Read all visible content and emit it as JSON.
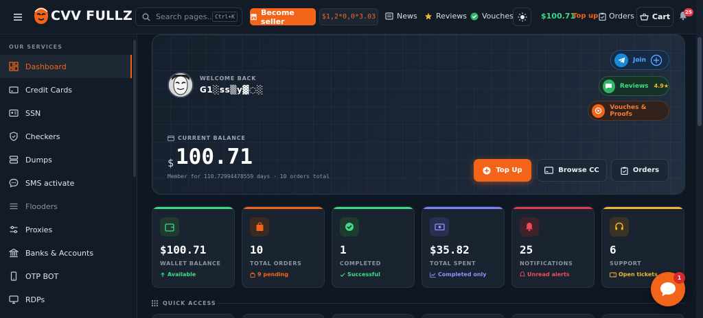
{
  "header": {
    "logo_text": "CVV FULLZ",
    "search_placeholder": "Search pages...",
    "search_shortcut": "Ctrl+K",
    "become_seller_label": "Become seller",
    "balance_ticker": "$1,2*0,0*3.03",
    "news_label": "News",
    "reviews_label": "Reviews",
    "vouches_label": "Vouches",
    "wallet_amount": "$100.71",
    "topup_label": "Top up",
    "orders_label": "Orders",
    "cart_label": "Cart",
    "notification_count": "25"
  },
  "sidebar": {
    "heading": "OUR SERVICES",
    "items": [
      {
        "label": "Dashboard",
        "icon": "dashboard-icon",
        "active": true
      },
      {
        "label": "Credit Cards",
        "icon": "credit-card-icon"
      },
      {
        "label": "SSN",
        "icon": "id-card-icon"
      },
      {
        "label": "Checkers",
        "icon": "shield-icon"
      },
      {
        "label": "Dumps",
        "icon": "database-icon"
      },
      {
        "label": "SMS activate",
        "icon": "chat-icon"
      },
      {
        "label": "Flooders",
        "icon": "list-icon",
        "muted": true
      },
      {
        "label": "Proxies",
        "icon": "sliders-icon"
      },
      {
        "label": "Banks & Accounts",
        "icon": "bank-icon"
      },
      {
        "label": "OTP BOT",
        "icon": "phone-icon"
      },
      {
        "label": "RDPs",
        "icon": "monitor-icon"
      }
    ]
  },
  "hero": {
    "welcome_label": "WELCOME BACK",
    "username": "G1░ss▒y▓◌░",
    "balance_label": "CURRENT BALANCE",
    "currency": "$",
    "balance_value": "100.71",
    "member_line": "Member for 110.72994478559 days  ·  10 orders total",
    "join_label": "Join",
    "reviews_label": "Reviews",
    "reviews_rating": "4.9★",
    "vouches_label": "Vouches & Proofs",
    "topup_button": "Top Up",
    "browse_button": "Browse CC",
    "orders_button": "Orders"
  },
  "stats": [
    {
      "value": "$100.71",
      "label": "WALLET BALANCE",
      "sub": "Available",
      "accent": "#3ddc84",
      "sub_color": "#3ddc84",
      "icon": "wallet-icon",
      "icon_bg": "#1f3a2e",
      "icon_color": "#3ddc84"
    },
    {
      "value": "10",
      "label": "TOTAL ORDERS",
      "sub": "9 pending",
      "accent": "#f26419",
      "sub_color": "#f26419",
      "icon": "shopping-bag-icon",
      "icon_bg": "#3b2a22",
      "icon_color": "#f26419"
    },
    {
      "value": "1",
      "label": "COMPLETED",
      "sub": "Successful",
      "accent": "#3ddc84",
      "sub_color": "#3ddc84",
      "icon": "check-circle-icon",
      "icon_bg": "#1f3a2e",
      "icon_color": "#3ddc84"
    },
    {
      "value": "$35.82",
      "label": "TOTAL SPENT",
      "sub": "Completed only",
      "accent": "#7c83f5",
      "sub_color": "#8b93ff",
      "icon": "cash-icon",
      "icon_bg": "#2a2f52",
      "icon_color": "#8b93ff"
    },
    {
      "value": "25",
      "label": "NOTIFICATIONS",
      "sub": "Unread alerts",
      "accent": "#e5394b",
      "sub_color": "#ef4b5b",
      "icon": "bell-icon",
      "icon_bg": "#3d2229",
      "icon_color": "#ef4b5b"
    },
    {
      "value": "6",
      "label": "SUPPORT",
      "sub": "Open tickets",
      "accent": "#f3b530",
      "sub_color": "#f3b530",
      "icon": "headset-icon",
      "icon_bg": "#3a3222",
      "icon_color": "#f3b530"
    }
  ],
  "quick_access_label": "QUICK ACCESS",
  "chat_badge": "1"
}
